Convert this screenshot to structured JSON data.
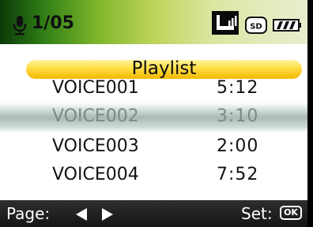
{
  "status_bar": {
    "counter": "1/05",
    "icons": [
      "microphone-icon",
      "device-connection-icon",
      "sd-card-icon",
      "battery-icon"
    ],
    "sd_label": "SD",
    "gradient_colors": [
      "#0c3a08",
      "#2f7d16",
      "#7fb72c",
      "#bed45a",
      "#e9edcf"
    ]
  },
  "playlist": {
    "title": "Playlist",
    "highlight_color": "#ffe04a",
    "selected_index": 1,
    "items": [
      {
        "name": "VOICE001",
        "duration": "5:12"
      },
      {
        "name": "VOICE002",
        "duration": "3:10"
      },
      {
        "name": "VOICE003",
        "duration": "2:00"
      },
      {
        "name": "VOICE004",
        "duration": "7:52"
      }
    ]
  },
  "footer": {
    "page_label": "Page:",
    "page_icons": [
      "previous-triangle-icon",
      "next-triangle-icon"
    ],
    "set_label": "Set:",
    "ok_label": "OK"
  }
}
